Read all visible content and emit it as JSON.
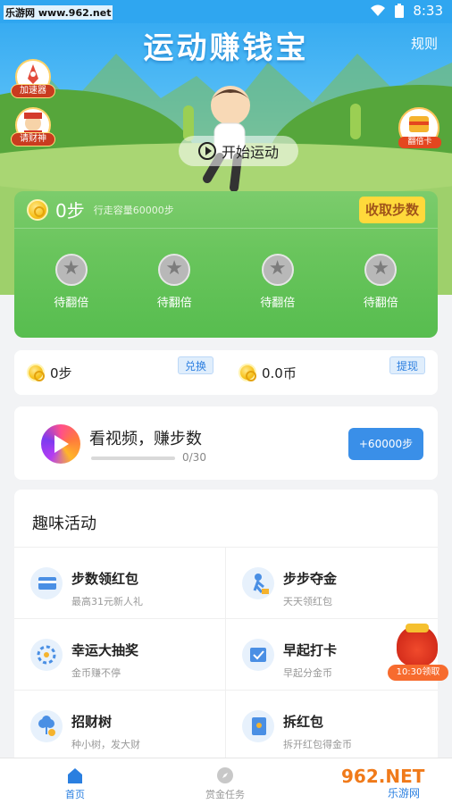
{
  "status_bar": {
    "watermark": "乐游网 www.962.net",
    "time": "8:33",
    "icons": [
      "wifi-icon",
      "battery-icon"
    ]
  },
  "header": {
    "title": "运动赚钱宝",
    "rules_label": "规则",
    "badges": [
      {
        "label": "加速器",
        "icon": "rocket-icon"
      },
      {
        "label": "请财神",
        "icon": "fortune-god-icon"
      }
    ],
    "double_card_label": "翻倍卡",
    "start_label": "开始运动"
  },
  "steps_panel": {
    "steps": "0步",
    "capacity": "行走容量60000步",
    "collect_label": "收取步数",
    "double_items": [
      "待翻倍",
      "待翻倍",
      "待翻倍",
      "待翻倍"
    ]
  },
  "balance": {
    "steps_value": "0步",
    "exchange_label": "兑换",
    "coins_value": "0.0币",
    "withdraw_label": "提现"
  },
  "video": {
    "title": "看视频，赚步数",
    "progress_text": "0/30",
    "progress_fraction": 0,
    "reward_label": "+60000步"
  },
  "activities": {
    "title": "趣味活动",
    "items": [
      {
        "name": "步数领红包",
        "sub": "最高31元新人礼",
        "icon": "red-packet-icon"
      },
      {
        "name": "步步夺金",
        "sub": "天天领红包",
        "icon": "runner-icon"
      },
      {
        "name": "幸运大抽奖",
        "sub": "金币赚不停",
        "icon": "lucky-draw-icon"
      },
      {
        "name": "早起打卡",
        "sub": "早起分金币",
        "icon": "check-in-icon"
      },
      {
        "name": "招财树",
        "sub": "种小树，发大财",
        "icon": "money-tree-icon"
      },
      {
        "name": "拆红包",
        "sub": "拆开红包得金币",
        "icon": "open-packet-icon"
      }
    ]
  },
  "floating_packet": {
    "label": "10:30领取"
  },
  "tabbar": {
    "tabs": [
      {
        "label": "首页",
        "icon": "home-icon",
        "active": true
      },
      {
        "label": "赏金任务",
        "icon": "compass-icon",
        "active": false
      }
    ]
  },
  "brand_watermark": "962.NET 乐游网",
  "colors": {
    "accent_blue": "#3a8fe8",
    "sky": "#2fa6f0",
    "grass": "#6ac55d",
    "gold": "#ffd93b"
  }
}
